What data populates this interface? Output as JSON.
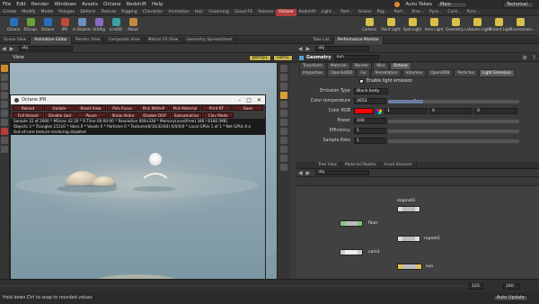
{
  "menubar": {
    "items": [
      "File",
      "Edit",
      "Render",
      "Windows",
      "Assets",
      "Octane",
      "Redshift",
      "Help"
    ],
    "auto_takes_label": "Auto Takes",
    "takes_value": "Main",
    "desktop_label": "Technical"
  },
  "shelf": {
    "tabs": [
      "Create",
      "Modify",
      "Model",
      "Polygon",
      "Deform",
      "Texture",
      "Rigging",
      "Character",
      "Animation",
      "Hair",
      "Grooming",
      "Cloud FX",
      "Volume",
      "Octane",
      "Redshift",
      "Light...",
      "Part...",
      "Grains",
      "Rigi...",
      "Part...",
      "Vise...",
      "Pyro...",
      "Cont...",
      "Pyro..."
    ],
    "active_tab": "Octane",
    "left_tools": [
      {
        "label": "Octane",
        "icon": "octane-render-icon"
      },
      {
        "label": "RSnaps",
        "icon": "snaps-icon"
      },
      {
        "label": "Octane",
        "icon": "octane-rop-icon"
      },
      {
        "label": "IPR",
        "icon": "ipr-icon"
      },
      {
        "label": "m.Objects",
        "icon": "objects-icon"
      },
      {
        "label": "OrbRig",
        "icon": "orbit-icon"
      },
      {
        "label": "LiveDB",
        "icon": "livedb-icon"
      },
      {
        "label": "About",
        "icon": "about-icon"
      }
    ],
    "right_tools": [
      {
        "label": "Camera",
        "icon": "camera-icon"
      },
      {
        "label": "Point Light",
        "icon": "point-light-icon"
      },
      {
        "label": "Spot Light",
        "icon": "spot-light-icon"
      },
      {
        "label": "Area Light",
        "icon": "area-light-icon"
      },
      {
        "label": "Geometry L...",
        "icon": "geometry-light-icon"
      },
      {
        "label": "Volume Light",
        "icon": "volume-light-icon"
      },
      {
        "label": "Distant Light",
        "icon": "distant-light-icon"
      },
      {
        "label": "Environmen...",
        "icon": "environment-light-icon"
      }
    ]
  },
  "left_pane": {
    "tabs": [
      "Scene View",
      "Animation Editor",
      "Render View",
      "Composite View",
      "Motion FX View",
      "Geometry Spreadsheet"
    ],
    "path": "obj",
    "view_label": "View",
    "camera_value": "persp1",
    "cam_value": "cam1"
  },
  "ipr": {
    "title": "Octane IPR",
    "row1": [
      "Reload",
      "Update",
      "Reset View",
      "Pick Focus",
      "Pick WhiteP",
      "Pick Material",
      "Print RT",
      "Save"
    ],
    "row2": [
      "Full Reload",
      "Disable Upd",
      "Pause",
      "Show Alpha",
      "Disable DOF",
      "Subsampling",
      "Clay Mode"
    ],
    "info_lines": [
      "Sample 32 of 2000 * MS/sec 42.20 * R.Time 00:00:00 * Resolution 604x338 * Memory(used/free) 346 / 6166 [MB]",
      "Objects 3 * Triangles 15116 * Hairs 0 * Voxels 0 * Particles 0 * Textures(8/16/32/64) 0/0/0/0 * Local GPUs 1 of 1 * Net GPUs 0 o",
      "Out-of-core texture rendering disabled"
    ]
  },
  "right_top": {
    "tabs": [
      "Take List",
      "Performance Monitor"
    ],
    "path": "obj",
    "node_type": "Geometry",
    "node_name": "sun",
    "tabs_row1": [
      "Transform",
      "Material",
      "Render",
      "Misc",
      "Octane"
    ],
    "active_row1": "Octane",
    "tabs_row2": [
      "Properties",
      "OpenSUBD",
      "Fur",
      "Tessellation",
      "Volumes",
      "OpenVDB",
      "Particles",
      "Light Emission"
    ],
    "active_row2": "Light Emission",
    "enable_light": "Enable light emission",
    "params": {
      "emission_type_label": "Emission Type",
      "emission_type_value": "Black body",
      "color_temp_label": "Color temperature",
      "color_temp_value": "2652",
      "color_temp_fraction": 0.27,
      "color_rgb_label": "Color RGB",
      "color_rgb_values": [
        "1",
        "0",
        "0"
      ],
      "power_label": "Power",
      "power_value": "100",
      "efficiency_label": "Efficiency",
      "efficiency_value": "1",
      "sample_rate_label": "Sample Rate",
      "sample_rate_value": "1"
    }
  },
  "network": {
    "tabs": [
      "Tree View",
      "Material Palette",
      "Asset Browser"
    ],
    "path": "obj",
    "nodes": [
      "stopnet1",
      "floor",
      "ropnet1",
      "cam1",
      "sun"
    ]
  },
  "timeline": {
    "frame": "125",
    "end": "240",
    "auto_update": "Auto Update"
  },
  "status": {
    "message": "Hold down Ctrl to snap to rounded values"
  }
}
